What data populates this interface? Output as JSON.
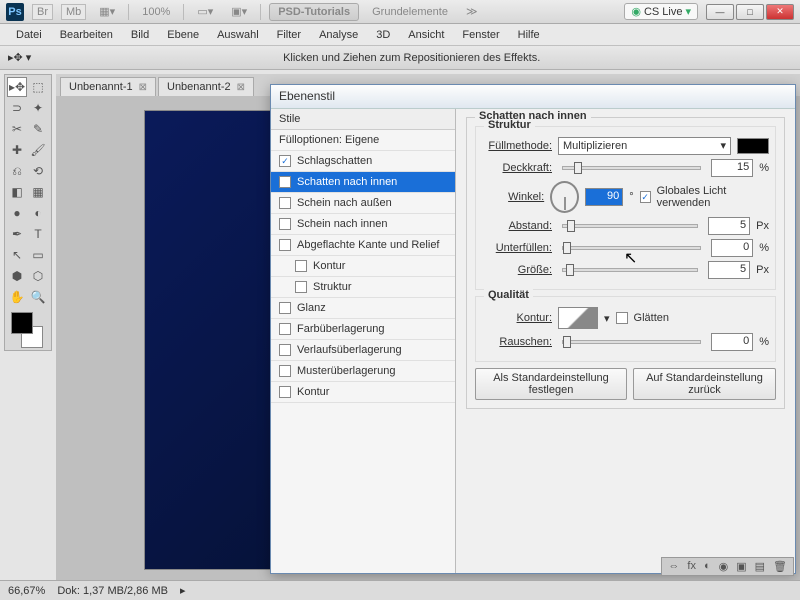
{
  "topbar": {
    "zoom": "100%",
    "tab1": "PSD-Tutorials",
    "tab2": "Grundelemente",
    "cslive": "CS Live"
  },
  "menu": [
    "Datei",
    "Bearbeiten",
    "Bild",
    "Ebene",
    "Auswahl",
    "Filter",
    "Analyse",
    "3D",
    "Ansicht",
    "Fenster",
    "Hilfe"
  ],
  "optbar_hint": "Klicken und Ziehen zum Repositionieren des Effekts.",
  "doc_tabs": [
    "Unbenannt-1",
    "Unbenannt-2"
  ],
  "status": {
    "zoom": "66,67%",
    "doc": "Dok: 1,37 MB/2,86 MB"
  },
  "dialog": {
    "title": "Ebenenstil",
    "styles_header": "Stile",
    "blend_options": "Fülloptionen: Eigene",
    "items": [
      {
        "label": "Schlagschatten",
        "checked": true,
        "sub": false
      },
      {
        "label": "Schatten nach innen",
        "checked": true,
        "sub": false,
        "selected": true
      },
      {
        "label": "Schein nach außen",
        "checked": false,
        "sub": false
      },
      {
        "label": "Schein nach innen",
        "checked": false,
        "sub": false
      },
      {
        "label": "Abgeflachte Kante und Relief",
        "checked": false,
        "sub": false
      },
      {
        "label": "Kontur",
        "checked": false,
        "sub": true
      },
      {
        "label": "Struktur",
        "checked": false,
        "sub": true
      },
      {
        "label": "Glanz",
        "checked": false,
        "sub": false
      },
      {
        "label": "Farbüberlagerung",
        "checked": false,
        "sub": false
      },
      {
        "label": "Verlaufsüberlagerung",
        "checked": false,
        "sub": false
      },
      {
        "label": "Musterüberlagerung",
        "checked": false,
        "sub": false
      },
      {
        "label": "Kontur",
        "checked": false,
        "sub": false
      }
    ],
    "panel_title": "Schatten nach innen",
    "struct_title": "Struktur",
    "quality_title": "Qualität",
    "labels": {
      "blendmode": "Füllmethode:",
      "opacity": "Deckkraft:",
      "angle": "Winkel:",
      "global": "Globales Licht verwenden",
      "distance": "Abstand:",
      "choke": "Unterfüllen:",
      "size": "Größe:",
      "contour": "Kontur:",
      "antialias": "Glätten",
      "noise": "Rauschen:"
    },
    "values": {
      "blendmode": "Multiplizieren",
      "opacity": "15",
      "angle": "90",
      "distance": "5",
      "choke": "0",
      "size": "5",
      "noise": "0"
    },
    "units": {
      "pct": "%",
      "deg": "°",
      "px": "Px"
    },
    "buttons": {
      "default": "Als Standardeinstellung festlegen",
      "reset": "Auf Standardeinstellung zurück"
    }
  }
}
